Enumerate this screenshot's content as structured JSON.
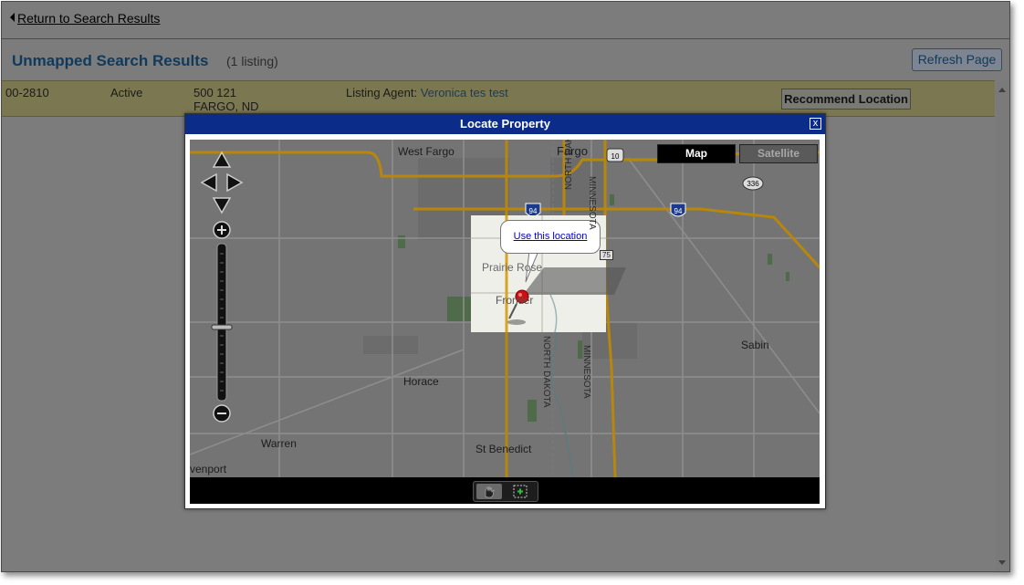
{
  "topbar": {
    "back_label": "Return to Search Results"
  },
  "results": {
    "title": "Unmapped Search Results",
    "count": "(1 listing)",
    "refresh_label": "Refresh Page",
    "row": {
      "id": "00-2810",
      "status": "Active",
      "address_line1": "500 121",
      "address_line2": "FARGO, ND",
      "agent_label": "Listing Agent:",
      "agent_name": "Veronica tes test",
      "recommend_label": "Recommend Location"
    }
  },
  "modal": {
    "title": "Locate Property",
    "close_symbol": "x",
    "map_types": {
      "map": "Map",
      "satellite": "Satellite"
    },
    "callout_link": "Use this location",
    "places": {
      "west_fargo": "West Fargo",
      "fargo": "Fargo",
      "prairie_rose": "Prairie Rose",
      "frontier": "Frontier",
      "sabin": "Sabin",
      "horace": "Horace",
      "warren": "Warren",
      "st_benedict": "St Benedict",
      "davenport": "venport",
      "north_dakota": "NORTH DAKOTA",
      "minnesota": "MINNESOTA"
    },
    "shields": {
      "i94": "94",
      "us10": "10",
      "us75": "75",
      "r336": "336"
    }
  },
  "colors": {
    "header_blue": "#0c2c8a",
    "link_blue": "#0000cc",
    "pin_red": "#cc1111",
    "highway": "#b8860b"
  }
}
